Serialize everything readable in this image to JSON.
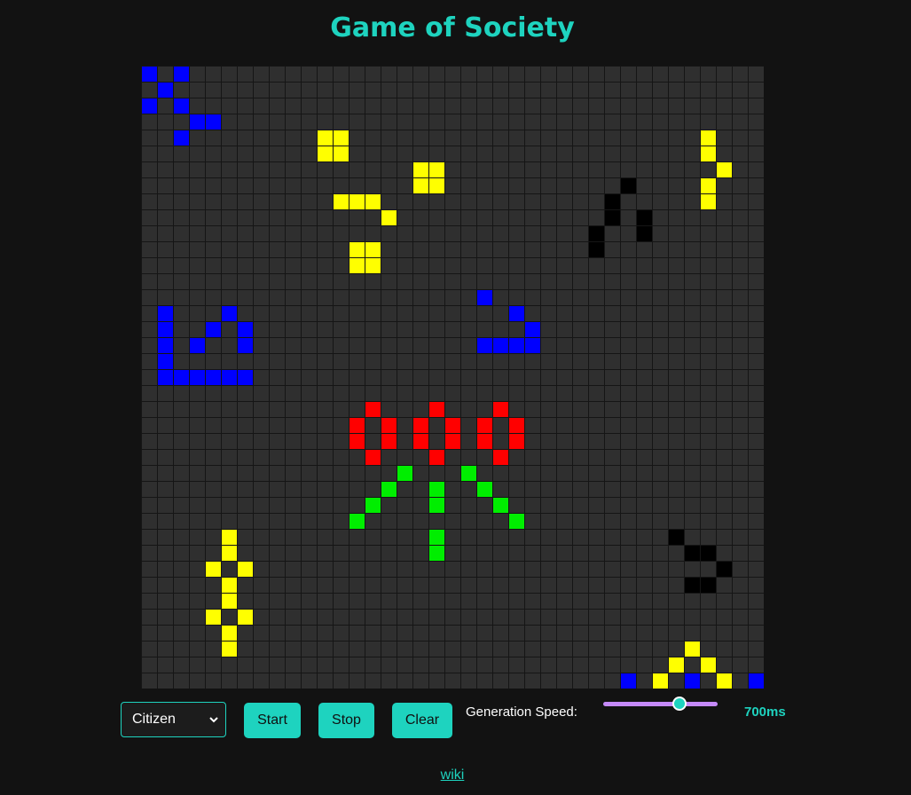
{
  "page": {
    "title": "Game of Society"
  },
  "board": {
    "rows": 39,
    "cols": 39,
    "empty_color": "#2f2f2f",
    "grid_line_color": "#151515",
    "colors": {
      "B": "#0000ff",
      "Y": "#ffff00",
      "K": "#000000",
      "R": "#ff0000",
      "G": "#00ee00"
    },
    "grid": [
      "B.B....................................",
      ".B.....................................",
      "B.B....................................",
      "..BB...................................",
      "..B....................................",
      "...........YY..........................",
      "...........YY.....................Y....",
      ".................YY................Y....",
      ".................YY................Y...",
      "............................K......Y....",
      "...........YYY.............K.......Y....",
      ".............Y.............K.K.........",
      "............................K.K.........",
      "............YY..............K..........",
      "............YY...........................",
      ".......................................",
      "...........................................",
      "............................................",
      ".............................................",
      "......................................",
      ".........................................",
      "..........................................",
      "...........................................",
      "..........................................",
      "...........................................",
      "...........................................",
      "...........................................",
      "...........................................",
      "...........................................",
      "...........................................",
      "...........................................",
      "...........................................",
      "...........................................",
      "...........................................",
      "...........................................",
      "...........................................",
      "...........................................",
      "...........................................",
      "..........................................."
    ]
  },
  "controls": {
    "role_select": {
      "selected": "Citizen"
    },
    "start_label": "Start",
    "stop_label": "Stop",
    "clear_label": "Clear",
    "speed_label": "Generation Speed:",
    "speed_value": "700ms",
    "speed_fraction": 0.67
  },
  "footer": {
    "wiki_label": "wiki"
  }
}
